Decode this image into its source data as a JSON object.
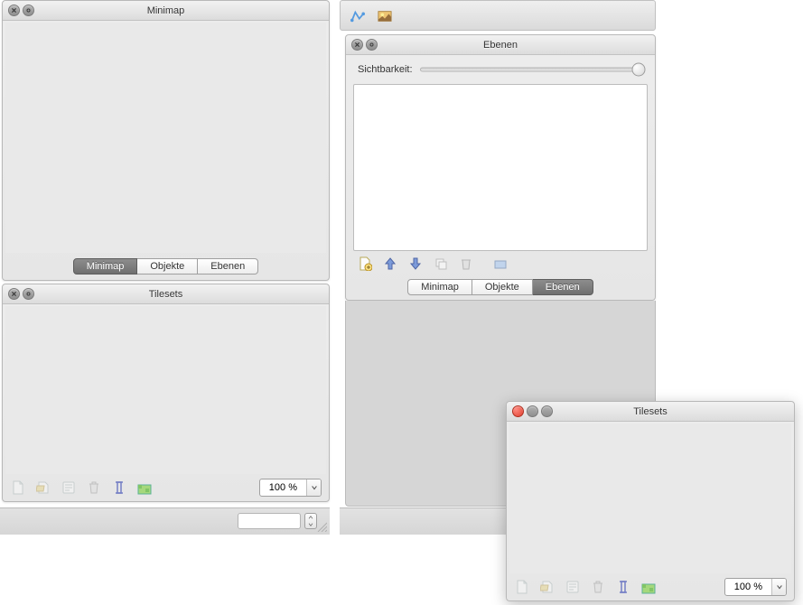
{
  "panels": {
    "minimap": {
      "title": "Minimap",
      "tabs": [
        "Minimap",
        "Objekte",
        "Ebenen"
      ],
      "active_tab": 0
    },
    "tilesets_left": {
      "title": "Tilesets",
      "zoom": "100 %"
    },
    "ebenen": {
      "title": "Ebenen",
      "visibility_label": "Sichtbarkeit:",
      "tabs": [
        "Minimap",
        "Objekte",
        "Ebenen"
      ],
      "active_tab": 2
    },
    "tilesets_float": {
      "title": "Tilesets",
      "zoom": "100 %"
    }
  },
  "icons": {
    "close": "close-icon",
    "maximize": "maximize-icon",
    "minimize": "minimize-icon",
    "new_doc": "new-document-icon",
    "open_doc": "open-document-icon",
    "properties": "properties-icon",
    "delete": "trash-icon",
    "rename": "rename-icon",
    "edit_tileset": "edit-tileset-icon",
    "new_layer": "new-layer-icon",
    "move_up": "move-up-icon",
    "move_down": "move-down-icon",
    "duplicate": "duplicate-layer-icon",
    "delete_layer": "delete-layer-icon",
    "other_layer": "other-layer-icon",
    "polyline_tool": "polyline-tool-icon",
    "image_tool": "insert-image-tool-icon"
  }
}
